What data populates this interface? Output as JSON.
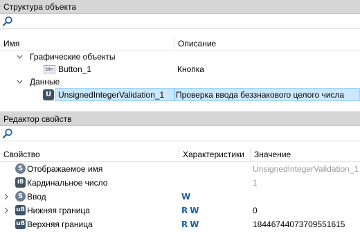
{
  "object_structure": {
    "title": "Структура объекта",
    "search_placeholder": "",
    "columns": {
      "name": "Имя",
      "description": "Описание"
    },
    "tree": [
      {
        "label": "Графические объекты",
        "description": "",
        "expanded": true,
        "icon": ""
      },
      {
        "label": "Button_1",
        "description": "Кнопка",
        "icon": "button-icon",
        "icon_text": "btn"
      },
      {
        "label": "Данные",
        "description": "",
        "expanded": true,
        "icon": ""
      },
      {
        "label": "UnsignedIntegerValidation_1",
        "description": "Проверка ввода беззнакового целого числа",
        "icon": "unsigned-validation-icon",
        "icon_text": "U",
        "selected": true
      }
    ]
  },
  "property_editor": {
    "title": "Редактор свойств",
    "search_placeholder": "",
    "columns": {
      "property": "Свойство",
      "characteristics": "Характеристики",
      "value": "Значение"
    },
    "rows": [
      {
        "badge": "S",
        "badge_icon": "string-type-icon",
        "name": "Отображаемое имя",
        "chars": "",
        "value": "UnsignedIntegerValidation_1",
        "value_grey": true,
        "expandable": false
      },
      {
        "badge": "i8",
        "badge_icon": "int8-type-icon",
        "name": "Кардинальное число",
        "chars": "",
        "value": "1",
        "value_grey": true,
        "expandable": false
      },
      {
        "badge": "S",
        "badge_icon": "string-type-icon",
        "name": "Ввод",
        "chars": "W",
        "value": "",
        "value_grey": false,
        "expandable": true
      },
      {
        "badge": "u8",
        "badge_icon": "uint8-type-icon",
        "name": "Нижняя граница",
        "chars": "RW",
        "value": "0",
        "value_grey": false,
        "expandable": true
      },
      {
        "badge": "u8",
        "badge_icon": "uint8-type-icon",
        "name": "Верхняя граница",
        "chars": "RW",
        "value": "18446744073709551615",
        "value_grey": false,
        "expandable": false
      }
    ]
  },
  "colors": {
    "selection": "#cce8ff",
    "selection_border": "#99d1ff",
    "header_bg": "#d6d6d6",
    "access_letters": "#1f5fa8"
  }
}
